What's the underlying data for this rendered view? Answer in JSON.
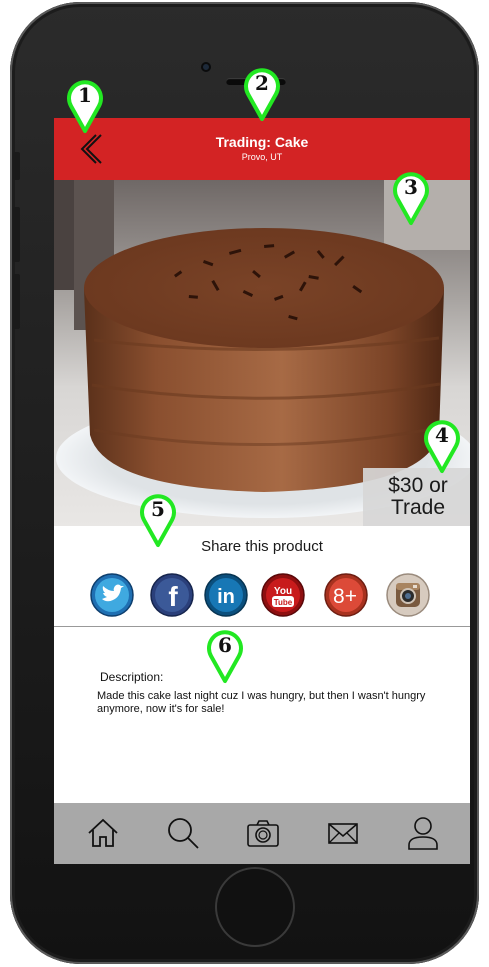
{
  "header": {
    "title": "Trading: Cake",
    "location": "Provo, UT"
  },
  "product": {
    "price_line1": "$30 or",
    "price_line2": "Trade",
    "share_title": "Share this product",
    "description_label": "Description:",
    "description": "Made this cake last night cuz I was hungry, but then I wasn't hungry anymore, now it's for sale!"
  },
  "social_icons": [
    "twitter-icon",
    "facebook-icon",
    "linkedin-icon",
    "youtube-icon",
    "google-plus-icon",
    "instagram-icon"
  ],
  "social_letters": {
    "facebook": "f",
    "linkedin": "in",
    "youtube_top": "You",
    "youtube_bottom": "Tube",
    "google_plus": "8+"
  },
  "nav_icons": [
    "home-icon",
    "search-icon",
    "camera-icon",
    "mail-icon",
    "profile-icon"
  ],
  "markers": [
    "1",
    "2",
    "3",
    "4",
    "5",
    "6"
  ],
  "colors": {
    "header_red": "#d32324",
    "bottom_bar": "#a8a8a8",
    "marker_green": "#22e822"
  }
}
